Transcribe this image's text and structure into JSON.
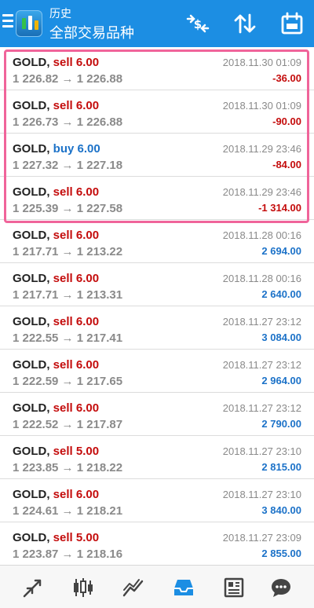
{
  "header": {
    "title": "历史",
    "subtitle": "全部交易品种"
  },
  "icons": {
    "menu": "menu-icon",
    "logo": "app-logo-icon",
    "currency": "currency-exchange-icon",
    "sort": "sort-icon",
    "calendar": "calendar-icon"
  },
  "colors": {
    "header_bg": "#1c8ee3",
    "sell": "#c40c0c",
    "buy": "#1c72c8",
    "negative": "#c40c0c",
    "positive": "#1c72c8",
    "highlight": "#f0649a",
    "active_nav": "#1c8ee3"
  },
  "trades": [
    {
      "symbol": "GOLD,",
      "side": "sell",
      "volume": "6.00",
      "prices": "1 226.82 → 1 226.88",
      "time": "2018.11.30 01:09",
      "profit": "-36.00"
    },
    {
      "symbol": "GOLD,",
      "side": "sell",
      "volume": "6.00",
      "prices": "1 226.73 → 1 226.88",
      "time": "2018.11.30 01:09",
      "profit": "-90.00"
    },
    {
      "symbol": "GOLD,",
      "side": "buy",
      "volume": "6.00",
      "prices": "1 227.32 → 1 227.18",
      "time": "2018.11.29 23:46",
      "profit": "-84.00"
    },
    {
      "symbol": "GOLD,",
      "side": "sell",
      "volume": "6.00",
      "prices": "1 225.39 → 1 227.58",
      "time": "2018.11.29 23:46",
      "profit": "-1 314.00"
    },
    {
      "symbol": "GOLD,",
      "side": "sell",
      "volume": "6.00",
      "prices": "1 217.71 → 1 213.22",
      "time": "2018.11.28 00:16",
      "profit": "2 694.00"
    },
    {
      "symbol": "GOLD,",
      "side": "sell",
      "volume": "6.00",
      "prices": "1 217.71 → 1 213.31",
      "time": "2018.11.28 00:16",
      "profit": "2 640.00"
    },
    {
      "symbol": "GOLD,",
      "side": "sell",
      "volume": "6.00",
      "prices": "1 222.55 → 1 217.41",
      "time": "2018.11.27 23:12",
      "profit": "3 084.00"
    },
    {
      "symbol": "GOLD,",
      "side": "sell",
      "volume": "6.00",
      "prices": "1 222.59 → 1 217.65",
      "time": "2018.11.27 23:12",
      "profit": "2 964.00"
    },
    {
      "symbol": "GOLD,",
      "side": "sell",
      "volume": "6.00",
      "prices": "1 222.52 → 1 217.87",
      "time": "2018.11.27 23:12",
      "profit": "2 790.00"
    },
    {
      "symbol": "GOLD,",
      "side": "sell",
      "volume": "5.00",
      "prices": "1 223.85 → 1 218.22",
      "time": "2018.11.27 23:10",
      "profit": "2 815.00"
    },
    {
      "symbol": "GOLD,",
      "side": "sell",
      "volume": "6.00",
      "prices": "1 224.61 → 1 218.21",
      "time": "2018.11.27 23:10",
      "profit": "3 840.00"
    },
    {
      "symbol": "GOLD,",
      "side": "sell",
      "volume": "5.00",
      "prices": "1 223.87 → 1 218.16",
      "time": "2018.11.27 23:09",
      "profit": "2 855.00"
    }
  ],
  "bottom_nav": [
    {
      "name": "quotes",
      "icon": "quotes-arrows-icon",
      "active": false
    },
    {
      "name": "charts",
      "icon": "candlestick-icon",
      "active": false
    },
    {
      "name": "trade",
      "icon": "trend-lines-icon",
      "active": false
    },
    {
      "name": "history",
      "icon": "inbox-tray-icon",
      "active": true
    },
    {
      "name": "news",
      "icon": "newspaper-icon",
      "active": false
    },
    {
      "name": "chat",
      "icon": "chat-bubble-icon",
      "active": false
    }
  ]
}
